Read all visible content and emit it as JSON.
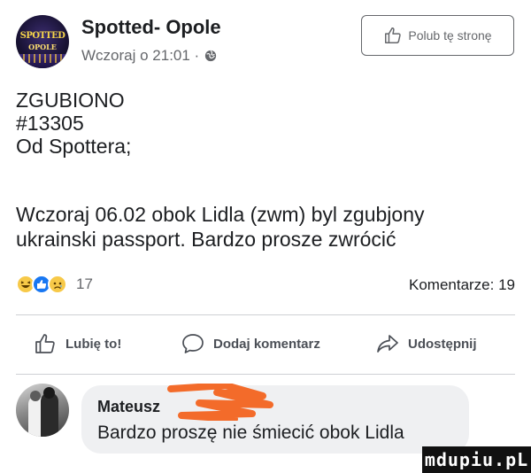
{
  "page": {
    "name": "Spotted- Opole",
    "meta": "Wczoraj o 21:01 ·",
    "avatar_text_line1": "SPOTTED",
    "avatar_text_line2": "OPOLE",
    "like_page_label": "Polub tę stronę"
  },
  "post": {
    "lines": [
      "ZGUBIONO",
      "#13305",
      "Od Spottera;"
    ],
    "body_lines": [
      "Wczoraj 06.02 obok Lidla (zwm)  byl zgubjony",
      "ukrainski passport. Bardzo prosze zwrócić"
    ]
  },
  "stats": {
    "reactions": [
      "haha",
      "like",
      "sad"
    ],
    "reaction_count": "17",
    "comments": "Komentarze: 19"
  },
  "actions": {
    "like": "Lubię to!",
    "comment": "Dodaj komentarz",
    "share": "Udostępnij"
  },
  "comment": {
    "author": "Mateusz",
    "text": "Bardzo proszę nie śmiecić obok Lidla",
    "redaction_color": "#f36b2a"
  },
  "watermark": "mdupiu.pL",
  "colors": {
    "text": "#1c1e21",
    "secondary": "#65676b",
    "like_blue": "#1877f2",
    "bubble": "#eff0f2"
  }
}
